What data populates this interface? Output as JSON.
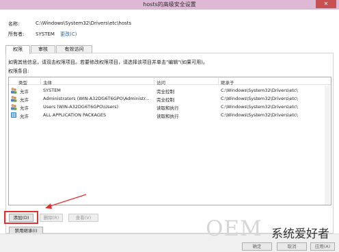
{
  "window": {
    "title": "hosts的高级安全设置",
    "close_glyph": "✕"
  },
  "info": {
    "name_label": "名称:",
    "name_value": "C:\\Windows\\System32\\Drivers\\etc\\hosts",
    "owner_label": "所有者:",
    "owner_value": "SYSTEM",
    "change_link": "更改(C)"
  },
  "tabs": [
    {
      "label": "权限",
      "active": true
    },
    {
      "label": "审核",
      "active": false
    },
    {
      "label": "有效访问",
      "active": false
    }
  ],
  "permissions": {
    "info_text": "如需其他信息，请双击权限项目。若要修改权限项目，请选择该项目并单击\"编辑\"(如果可用)。",
    "entries_label": "权限条目:",
    "columns": [
      "类型",
      "主体",
      "访问",
      "继承于"
    ],
    "rows": [
      {
        "icon": "user-group-icon",
        "type": "允许",
        "principal": "SYSTEM",
        "access": "完全控制",
        "inherited": "C:\\Windows\\System32\\Drivers\\etc\\"
      },
      {
        "icon": "user-group-icon",
        "type": "允许",
        "principal": "Administrators (WIN-A32DG6T6GPO\\Administr...",
        "access": "完全控制",
        "inherited": "C:\\Windows\\System32\\Drivers\\etc\\"
      },
      {
        "icon": "user-group-icon",
        "type": "允许",
        "principal": "Users (WIN-A32DG6T6GPO\\Users)",
        "access": "读取和执行",
        "inherited": "C:\\Windows\\System32\\Drivers\\etc\\"
      },
      {
        "icon": "app-package-icon",
        "type": "允许",
        "principal": "ALL APPLICATION PACKAGES",
        "access": "读取和执行",
        "inherited": "C:\\Windows\\System32\\Drivers\\etc\\"
      }
    ]
  },
  "buttons": {
    "add": "添加(D)",
    "remove": "删除(R)",
    "view": "查看(V)",
    "disable_inheritance": "禁用继承(I)",
    "ok": "确定",
    "cancel": "取消",
    "apply": "应用(A)"
  },
  "watermark": {
    "brand": "OEM",
    "tagline": "系统爱好者"
  },
  "colors": {
    "titlebar": "#ddb9d5",
    "close": "#c75050",
    "highlight": "#e03030",
    "arrow": "#e03030"
  }
}
